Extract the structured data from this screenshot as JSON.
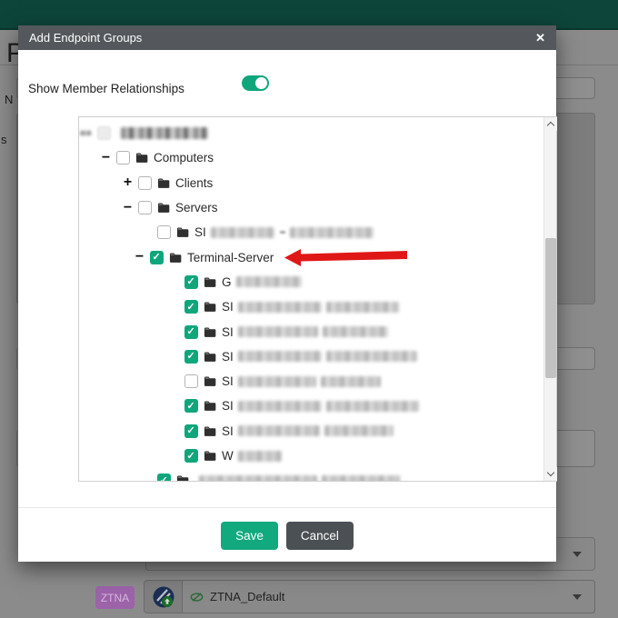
{
  "page": {
    "heading_partial": "P",
    "field_label_1": "N",
    "field_label_2": "s",
    "ztna_badge": "ZTNA",
    "ztna_profile_value": "ZTNA_Default"
  },
  "modal": {
    "title": "Add Endpoint Groups",
    "close_glyph": "✕",
    "toggle_label": "Show Member Relationships",
    "toggle_on": true,
    "save_label": "Save",
    "cancel_label": "Cancel"
  },
  "tree": {
    "rows": [
      {
        "name": "root-node-redacted",
        "level": 0,
        "blurred_root": true
      },
      {
        "name": "computers",
        "label": "Computers",
        "level": 1,
        "expander": "minus",
        "checked": false
      },
      {
        "name": "clients",
        "label": "Clients",
        "level": 2,
        "expander": "plus",
        "checked": false
      },
      {
        "name": "servers",
        "label": "Servers",
        "level": 2,
        "expander": "minus",
        "checked": false
      },
      {
        "name": "redacted-server",
        "prefix": "SI",
        "level": 3,
        "checked": false,
        "blobs": [
          70,
          92
        ],
        "dash": true
      },
      {
        "name": "terminal-server",
        "label": "Terminal-Server",
        "level": 3,
        "expander": "minus",
        "checked": true,
        "arrow": true
      },
      {
        "name": "redacted-member",
        "prefix": "G",
        "level": 4,
        "checked": true,
        "blobs": [
          72
        ]
      },
      {
        "name": "redacted-member",
        "prefix": "SI",
        "level": 4,
        "checked": true,
        "blobs": [
          92,
          80
        ]
      },
      {
        "name": "redacted-member",
        "prefix": "SI",
        "level": 4,
        "checked": true,
        "blobs": [
          88,
          72
        ]
      },
      {
        "name": "redacted-member",
        "prefix": "SI",
        "level": 4,
        "checked": true,
        "blobs": [
          92,
          100
        ]
      },
      {
        "name": "redacted-member",
        "prefix": "SI",
        "level": 4,
        "checked": false,
        "blobs": [
          86,
          66
        ]
      },
      {
        "name": "redacted-member",
        "prefix": "SI",
        "level": 4,
        "checked": true,
        "blobs": [
          92,
          102
        ]
      },
      {
        "name": "redacted-member",
        "prefix": "SI",
        "level": 4,
        "checked": true,
        "blobs": [
          90,
          76
        ]
      },
      {
        "name": "redacted-member",
        "prefix": "W",
        "level": 4,
        "checked": true,
        "blobs": [
          48
        ]
      },
      {
        "name": "redacted-sibling",
        "prefix": "",
        "level": 3,
        "checked": true,
        "blobs": [
          130,
          86
        ]
      }
    ]
  },
  "colors": {
    "accent_green": "#10a67c",
    "modal_header_gray": "#54585c",
    "cancel_gray": "#4b5055",
    "arrow_red": "#e01717",
    "badge_purple": "#9c63a9",
    "topbar_teal": "#0d453a"
  }
}
